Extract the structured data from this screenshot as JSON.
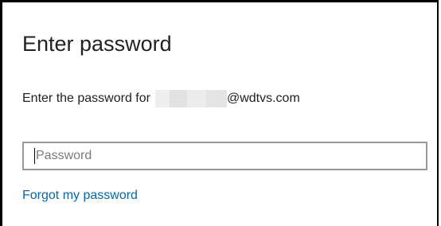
{
  "dialog": {
    "title": "Enter password",
    "prompt_prefix": "Enter the password for",
    "account_domain": "@wdtvs.com",
    "password": {
      "value": "",
      "placeholder": "Password"
    },
    "forgot_link": "Forgot my password"
  },
  "colors": {
    "link": "#0067b8",
    "text": "#222222",
    "input_border": "#999999"
  }
}
